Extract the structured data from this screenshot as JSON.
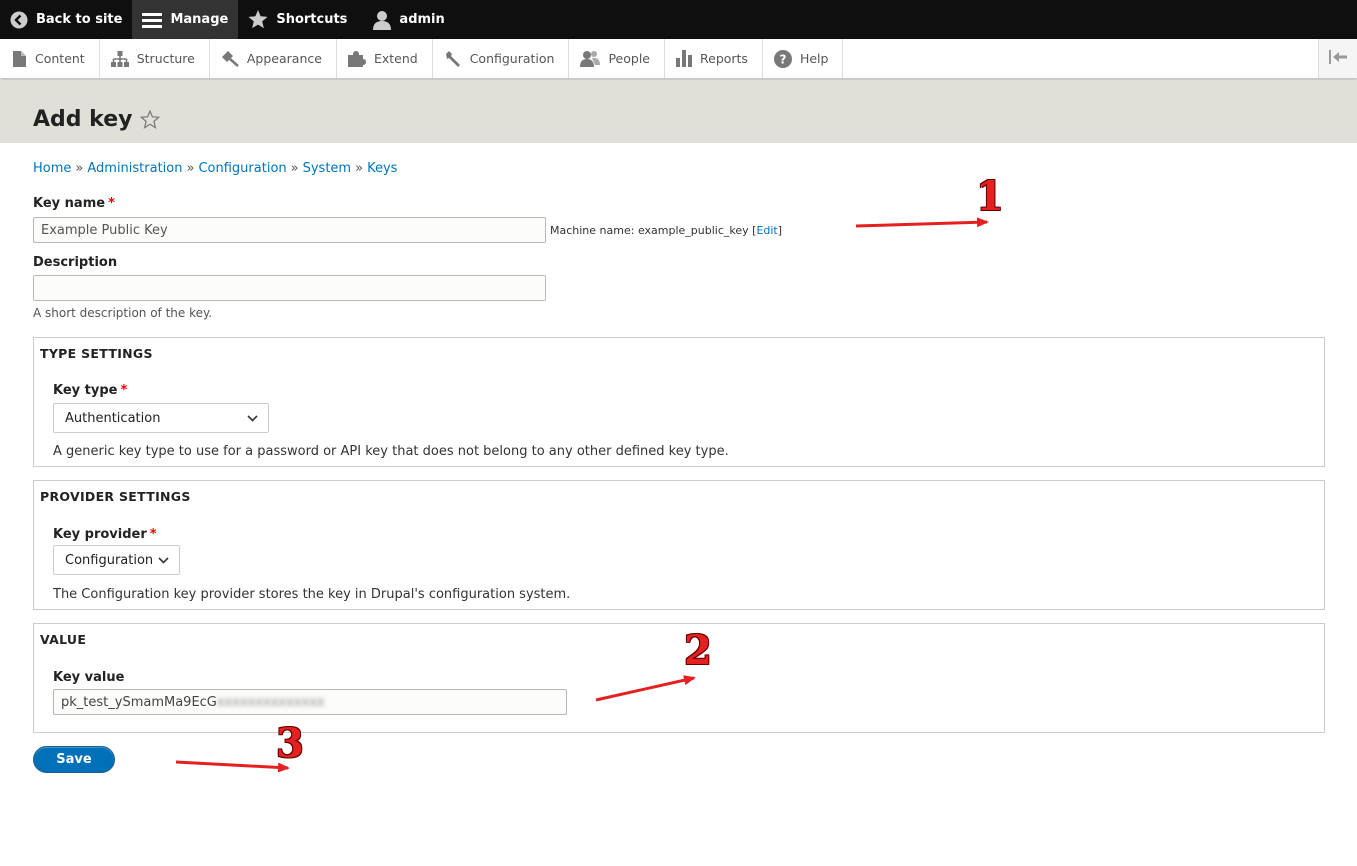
{
  "toolbar": {
    "back_to_site": "Back to site",
    "manage": "Manage",
    "shortcuts": "Shortcuts",
    "user": "admin"
  },
  "tray": {
    "items": [
      {
        "label": "Content",
        "icon": "file-icon"
      },
      {
        "label": "Structure",
        "icon": "sitemap-icon"
      },
      {
        "label": "Appearance",
        "icon": "paintbrush-icon"
      },
      {
        "label": "Extend",
        "icon": "puzzle-icon"
      },
      {
        "label": "Configuration",
        "icon": "wrench-icon"
      },
      {
        "label": "People",
        "icon": "people-icon"
      },
      {
        "label": "Reports",
        "icon": "bar-chart-icon"
      },
      {
        "label": "Help",
        "icon": "help-icon"
      }
    ]
  },
  "page": {
    "title": "Add key"
  },
  "breadcrumb": [
    "Home",
    "Administration",
    "Configuration",
    "System",
    "Keys"
  ],
  "form": {
    "key_name_label": "Key name",
    "key_name_value": "Example Public Key",
    "machine_name_prefix": "Machine name: example_public_key",
    "machine_name_edit": "Edit",
    "description_label": "Description",
    "description_value": "",
    "description_help": "A short description of the key.",
    "type_settings": {
      "legend": "TYPE SETTINGS",
      "key_type_label": "Key type",
      "key_type_value": "Authentication",
      "key_type_help": "A generic key type to use for a password or API key that does not belong to any other defined key type."
    },
    "provider_settings": {
      "legend": "PROVIDER SETTINGS",
      "key_provider_label": "Key provider",
      "key_provider_value": "Configuration",
      "key_provider_help": "The Configuration key provider stores the key in Drupal's configuration system."
    },
    "value": {
      "legend": "VALUE",
      "key_value_label": "Key value",
      "key_value_visible": "pk_test_ySmamMa9EcG",
      "key_value_blurred": "xxxxxxxxxxxxxx"
    },
    "save_label": "Save"
  },
  "annotations": [
    "1",
    "2",
    "3"
  ],
  "colors": {
    "link": "#0074bd",
    "primary_button": "#0071b8",
    "required": "#e00000",
    "annotation": "#e52020",
    "toolbar_bg": "#0f0f0f"
  }
}
